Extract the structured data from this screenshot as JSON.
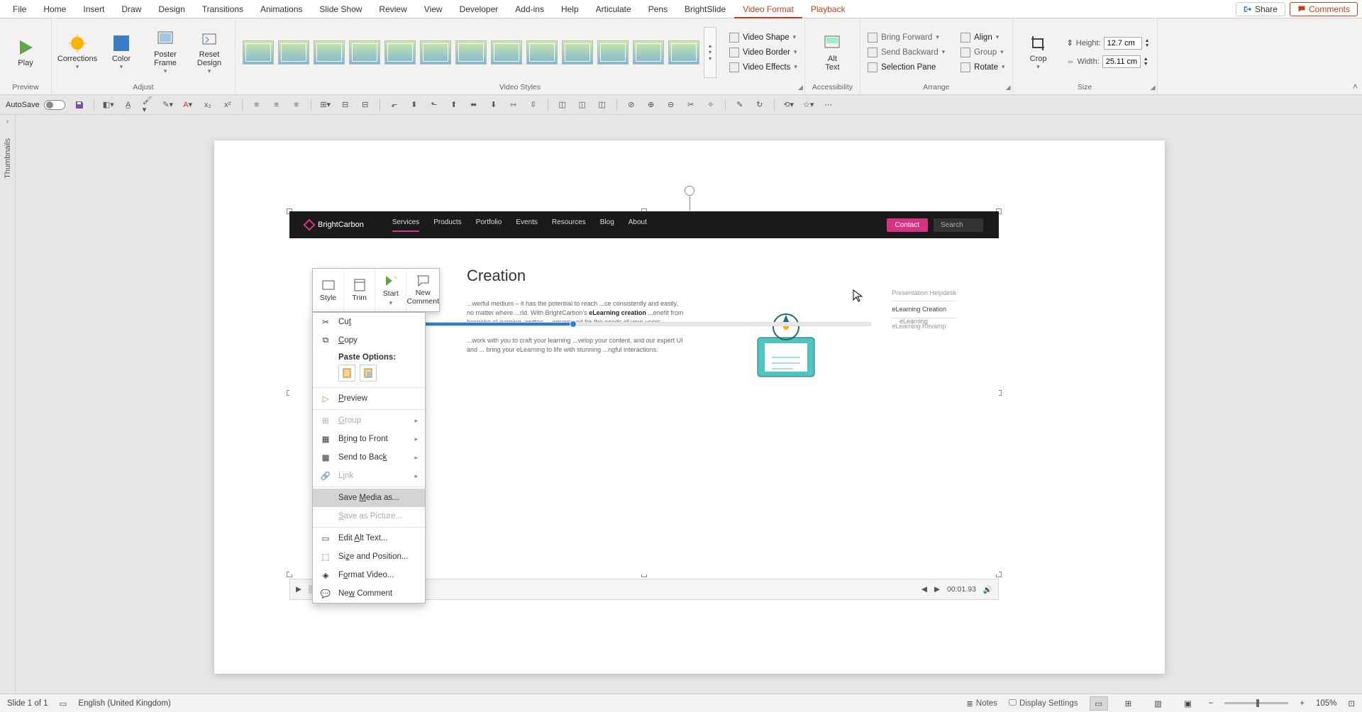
{
  "menu": {
    "items": [
      "File",
      "Home",
      "Insert",
      "Draw",
      "Design",
      "Transitions",
      "Animations",
      "Slide Show",
      "Review",
      "View",
      "Developer",
      "Add-ins",
      "Help",
      "Articulate",
      "Pens",
      "BrightSlide",
      "Video Format",
      "Playback"
    ],
    "active": "Video Format",
    "share": "Share",
    "comments": "Comments"
  },
  "ribbon": {
    "preview": {
      "play": "Play",
      "group": "Preview"
    },
    "adjust": {
      "corrections": "Corrections",
      "color": "Color",
      "poster": "Poster\nFrame",
      "reset": "Reset\nDesign",
      "group": "Adjust"
    },
    "styles": {
      "group": "Video Styles",
      "shape": "Video Shape",
      "border": "Video Border",
      "effects": "Video Effects"
    },
    "acc": {
      "alt": "Alt\nText",
      "group": "Accessibility"
    },
    "arrange": {
      "fwd": "Bring Forward",
      "back": "Send Backward",
      "sel": "Selection Pane",
      "align": "Align",
      "group_btn": "Group",
      "rotate": "Rotate",
      "group": "Arrange"
    },
    "size": {
      "crop": "Crop",
      "h": "Height:",
      "w": "Width:",
      "hval": "12.7 cm",
      "wval": "25.11 cm",
      "group": "Size"
    }
  },
  "qat": {
    "autosave": "AutoSave"
  },
  "thumb": {
    "label": "Thumbnails"
  },
  "mini": {
    "style": "Style",
    "trim": "Trim",
    "start": "Start",
    "new_comment": "New\nComment"
  },
  "ctx": {
    "cut": "Cut",
    "copy": "Copy",
    "paste_hdr": "Paste Options:",
    "preview": "Preview",
    "group": "Group",
    "btf": "Bring to Front",
    "stb": "Send to Back",
    "link": "Link",
    "save_media": "Save Media as...",
    "save_pic": "Save as Picture...",
    "alt": "Edit Alt Text...",
    "sizepos": "Size and Position...",
    "fmt": "Format Video...",
    "nc": "New Comment"
  },
  "video_page": {
    "brand": "BrightCarbon",
    "nav": [
      "Services",
      "Products",
      "Portfolio",
      "Events",
      "Resources",
      "Blog",
      "About"
    ],
    "contact": "Contact",
    "search": "Search",
    "title": "Creation",
    "p1": "...werful medium – it has the potential to reach ...ce consistently and easily, no matter where ...rld. With BrightCarbon's ",
    "p1b": "eLearning creation",
    "p1c": " ...enefit from bespoke eLearning, written, ...ogrammed for the needs of your users.",
    "p2": "...work with you to craft your learning ...velop your content, and our expert UI and ... bring your eLearning to life with stunning ...ngful interactions.",
    "side": [
      "Presentation Helpdesk",
      "eLearning Creation",
      "eLearning Revamp"
    ],
    "prog_lbl": "eLearning"
  },
  "player": {
    "time": "00:01.93"
  },
  "status": {
    "slide": "Slide 1 of 1",
    "lang": "English (United Kingdom)",
    "notes": "Notes",
    "display": "Display Settings",
    "zoom": "105%"
  }
}
